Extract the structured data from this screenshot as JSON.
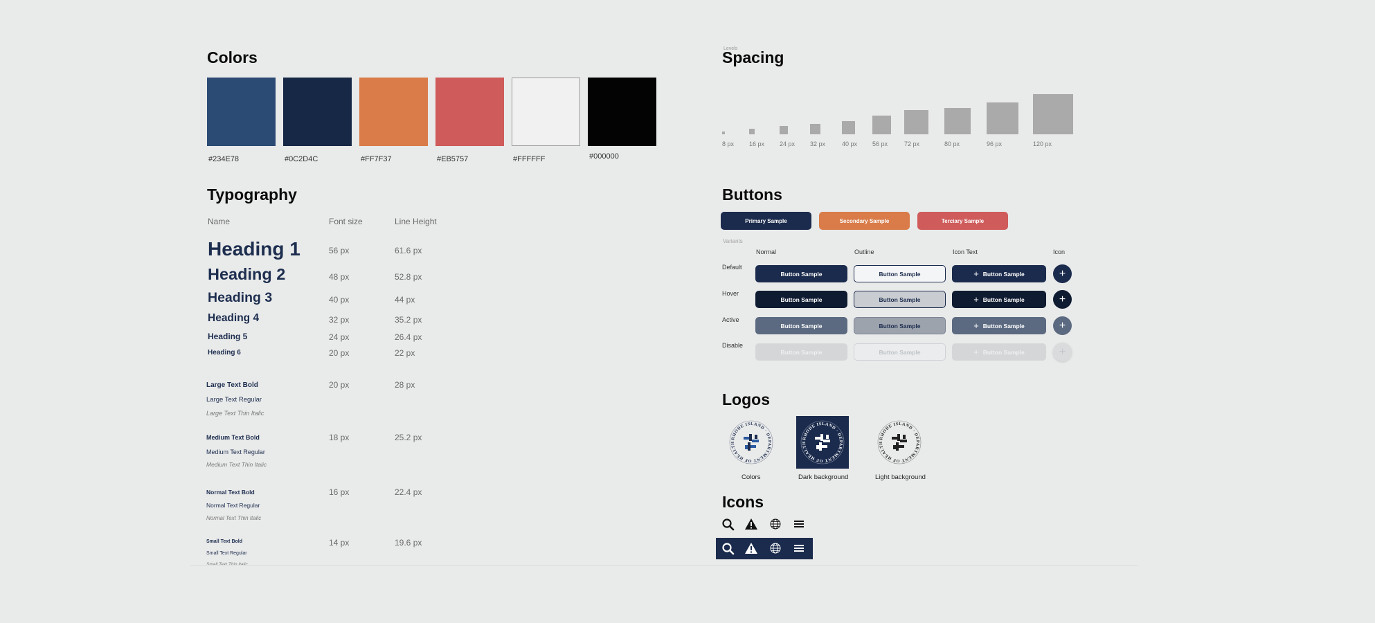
{
  "colors": {
    "title": "Colors",
    "swatches": [
      {
        "hex": "#234E78",
        "label": "#234E78"
      },
      {
        "hex": "#0C2D4C",
        "label": "#0C2D4C"
      },
      {
        "hex": "#FF7F37",
        "label": "#FF7F37"
      },
      {
        "hex": "#EB5757",
        "label": "#EB5757"
      },
      {
        "hex": "#FFFFFF",
        "label": "#FFFFFF"
      },
      {
        "hex": "#000000",
        "label": "#000000"
      }
    ]
  },
  "typography": {
    "title": "Typography",
    "headers": {
      "name": "Name",
      "size": "Font size",
      "line": "Line Height"
    },
    "headings": [
      {
        "name": "Heading 1",
        "size": "56 px",
        "line": "61.6 px"
      },
      {
        "name": "Heading 2",
        "size": "48 px",
        "line": "52.8 px"
      },
      {
        "name": "Heading 3",
        "size": "40 px",
        "line": "44 px"
      },
      {
        "name": "Heading 4",
        "size": "32 px",
        "line": "35.2 px"
      },
      {
        "name": "Heading 5",
        "size": "24 px",
        "line": "26.4 px"
      },
      {
        "name": "Heading 6",
        "size": "20 px",
        "line": "22 px"
      }
    ],
    "text_groups": [
      {
        "bold": "Large Text Bold",
        "regular": "Large Text Regular",
        "italic": "Large Text Thin Italic",
        "size": "20 px",
        "line": "28 px"
      },
      {
        "bold": "Medium Text Bold",
        "regular": "Medium Text Regular",
        "italic": "Medium Text Thin Italic",
        "size": "18 px",
        "line": "25.2 px"
      },
      {
        "bold": "Normal Text Bold",
        "regular": "Normal Text Regular",
        "italic": "Normal Text Thin Italic",
        "size": "16 px",
        "line": "22.4 px"
      },
      {
        "bold": "Small Text Bold",
        "regular": "Small Text Regular",
        "italic": "Small Text Thin Italic",
        "size": "14 px",
        "line": "19.6 px"
      }
    ]
  },
  "spacing": {
    "title": "Spacing",
    "caption": "Levels",
    "levels": [
      {
        "label": "8 px",
        "value": 8
      },
      {
        "label": "16 px",
        "value": 16
      },
      {
        "label": "24 px",
        "value": 24
      },
      {
        "label": "32 px",
        "value": 32
      },
      {
        "label": "40 px",
        "value": 40
      },
      {
        "label": "56 px",
        "value": 56
      },
      {
        "label": "72 px",
        "value": 72
      },
      {
        "label": "80 px",
        "value": 80
      },
      {
        "label": "96 px",
        "value": 96
      },
      {
        "label": "120 px",
        "value": 120
      }
    ]
  },
  "buttons": {
    "title": "Buttons",
    "samples": [
      {
        "label": "Primary Sample",
        "color": "#1b2b4d"
      },
      {
        "label": "Secondary Sample",
        "color": "#d97c49"
      },
      {
        "label": "Terciary Sample",
        "color": "#cf5b5b"
      }
    ],
    "variants_caption": "Variants",
    "columns": [
      "Normal",
      "Outline",
      "Icon Text",
      "Icon"
    ],
    "rows": [
      "Default",
      "Hover",
      "Active",
      "Disable"
    ],
    "button_label": "Button Sample",
    "plus": "+"
  },
  "logos": {
    "title": "Logos",
    "items": [
      {
        "label": "Colors"
      },
      {
        "label": "Dark background"
      },
      {
        "label": "Light background"
      }
    ],
    "ring_text": "RHODE ISLAND · DEPARTMENT OF HEALTH ·"
  },
  "icons": {
    "title": "Icons",
    "names": [
      "search-icon",
      "warning-icon",
      "globe-icon",
      "menu-icon"
    ],
    "dark_bg": "#1b2b4d"
  }
}
